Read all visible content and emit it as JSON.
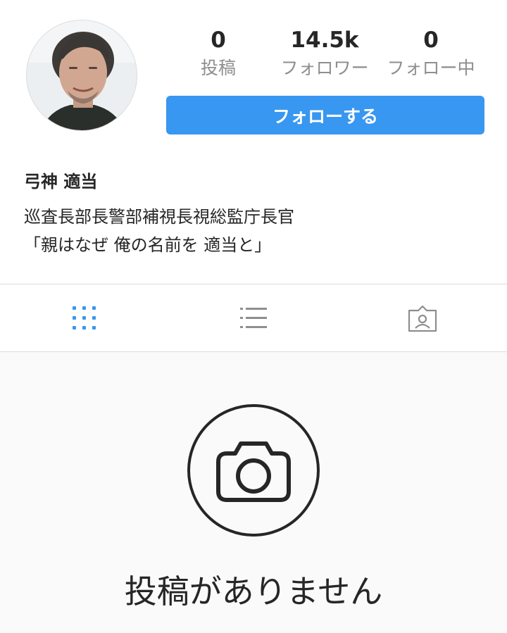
{
  "profile": {
    "name": "弓神 適当",
    "bio_lines": [
      "巡査長部長警部補視長視総監庁長官",
      "「親はなぜ 俺の名前を 適当と」"
    ]
  },
  "stats": {
    "posts": {
      "value": "0",
      "label": "投稿"
    },
    "followers": {
      "value": "14.5k",
      "label": "フォロワー"
    },
    "following": {
      "value": "0",
      "label": "フォロー中"
    }
  },
  "actions": {
    "follow_label": "フォローする"
  },
  "tabs": [
    {
      "icon": "grid-icon",
      "active": true
    },
    {
      "icon": "list-icon",
      "active": false
    },
    {
      "icon": "tagged-icon",
      "active": false
    }
  ],
  "empty_state": {
    "icon": "camera-icon",
    "message": "投稿がありません"
  },
  "colors": {
    "accent": "#3897f0",
    "text": "#262626",
    "muted": "#8e8e8e",
    "divider": "#dbdbdb",
    "empty_bg": "#fafafa"
  }
}
